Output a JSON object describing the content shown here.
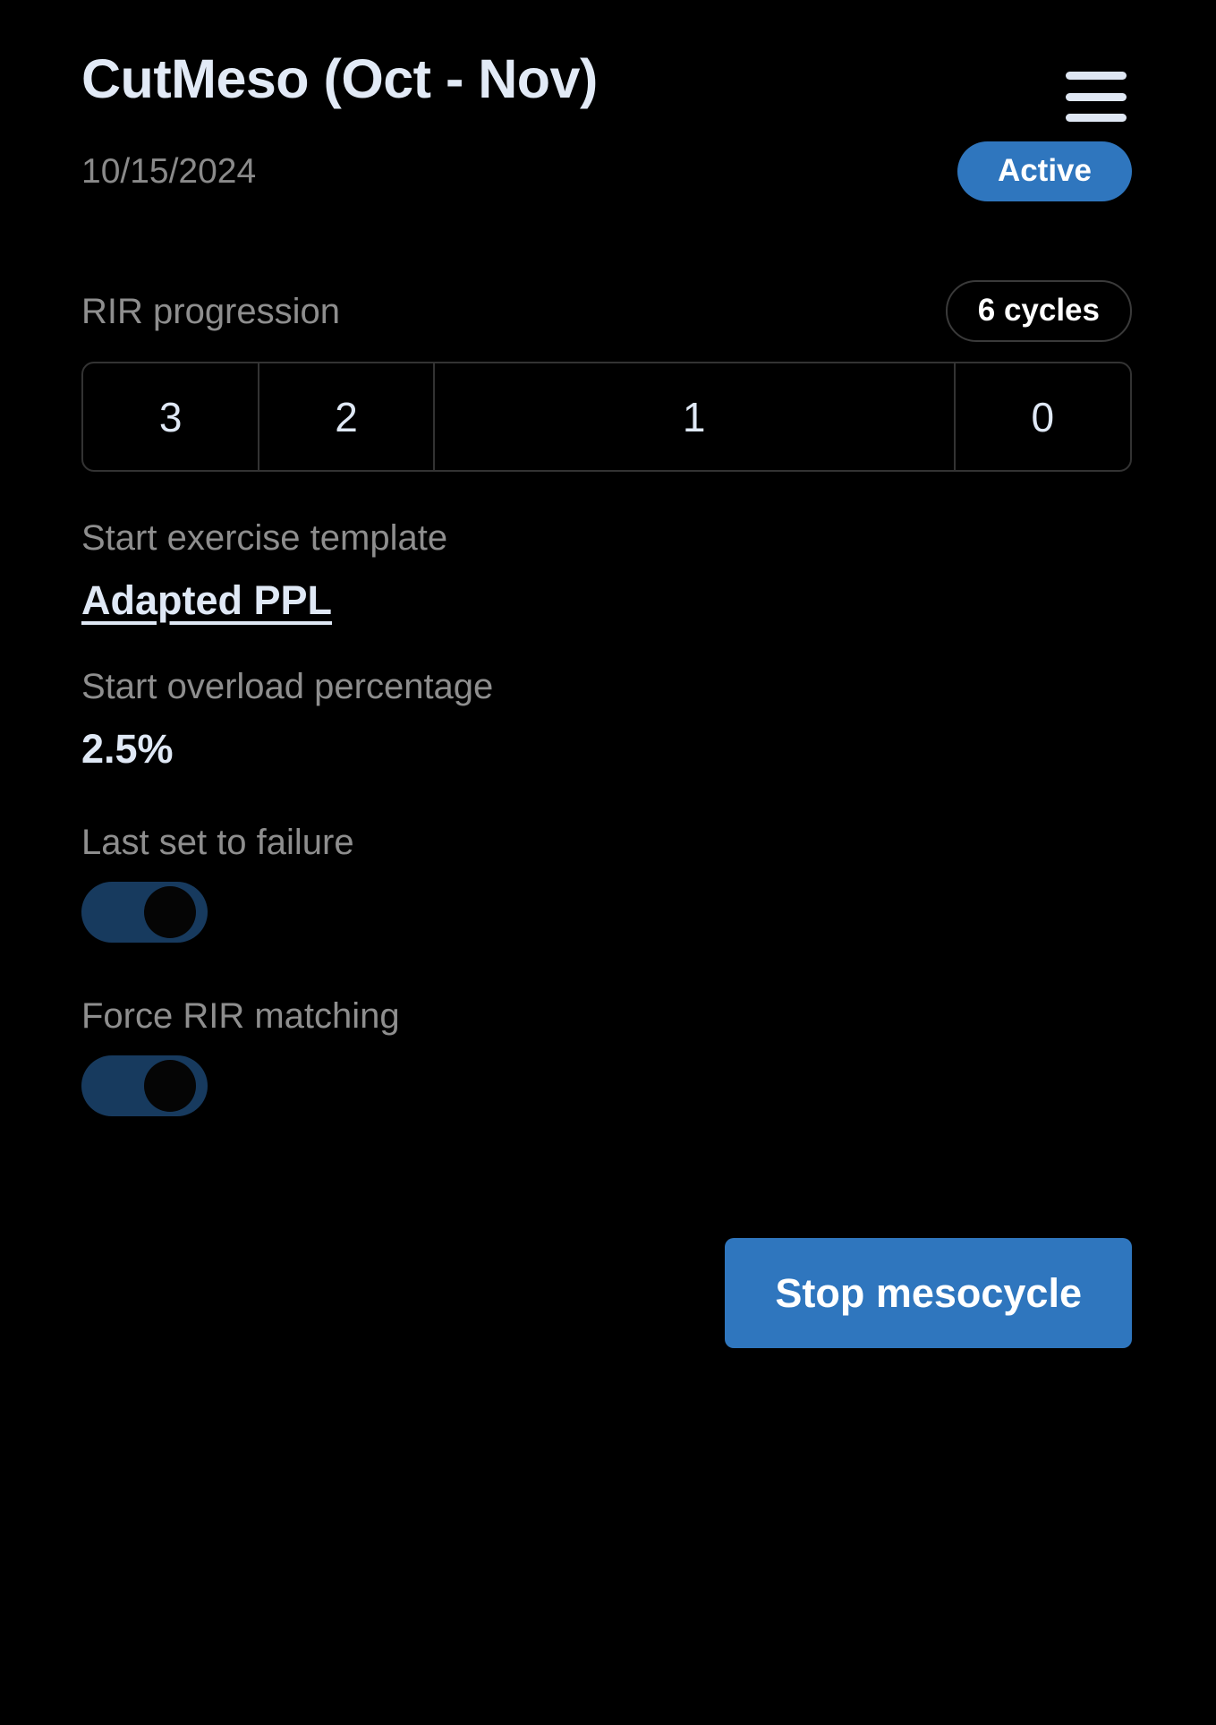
{
  "header": {
    "title": "CutMeso (Oct - Nov)",
    "date": "10/15/2024",
    "status_badge": "Active",
    "menu_icon": "hamburger-menu-icon"
  },
  "rir_progression": {
    "label": "RIR progression",
    "cycles_chip": "6 cycles",
    "segments": [
      {
        "value": "3",
        "flex": 197
      },
      {
        "value": "2",
        "flex": 195
      },
      {
        "value": "1",
        "flex": 585
      },
      {
        "value": "0",
        "flex": 197
      }
    ]
  },
  "exercise_template": {
    "label": "Start exercise template",
    "value": "Adapted PPL"
  },
  "overload": {
    "label": "Start overload percentage",
    "value": "2.5%"
  },
  "last_set_to_failure": {
    "label": "Last set to failure",
    "state": "on"
  },
  "force_rir_matching": {
    "label": "Force RIR matching",
    "state": "on"
  },
  "footer": {
    "stop_button": "Stop mesocycle"
  },
  "colors": {
    "background": "#000000",
    "accent_blue": "#2f76be",
    "toggle_track": "#173a5e",
    "text_primary": "#dfe8f5",
    "text_muted": "#8e8e8e",
    "border": "#333333"
  }
}
